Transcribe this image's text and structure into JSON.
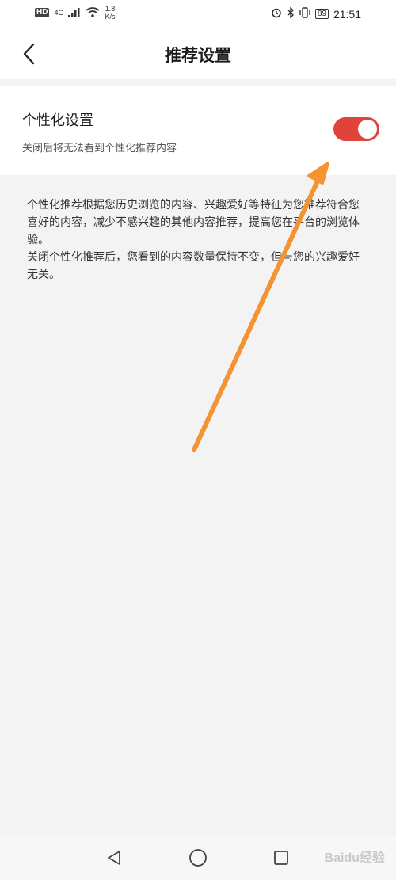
{
  "status_bar": {
    "hd": "HD",
    "network": "4G",
    "speed_value": "1.8",
    "speed_unit": "K/s",
    "battery": "89",
    "time": "21:51"
  },
  "header": {
    "title": "推荐设置",
    "back_icon": "chevron-left-icon"
  },
  "setting": {
    "title": "个性化设置",
    "subtitle": "关闭后将无法看到个性化推荐内容",
    "toggle_on": true,
    "toggle_color": "#e0433a"
  },
  "description": {
    "line1": "个性化推荐根据您历史浏览的内容、兴趣爱好等特征为您推荐符合您喜好的内容，减少不感兴趣的其他内容推荐，提高您在平台的浏览体验。",
    "line2": "关闭个性化推荐后，您看到的内容数量保持不变，但与您的兴趣爱好无关。"
  },
  "annotation": {
    "arrow_color": "#f39332"
  },
  "system_nav": {
    "back": "triangle-back-icon",
    "home": "circle-home-icon",
    "recents": "square-recents-icon"
  },
  "watermark": "Baidu经验"
}
